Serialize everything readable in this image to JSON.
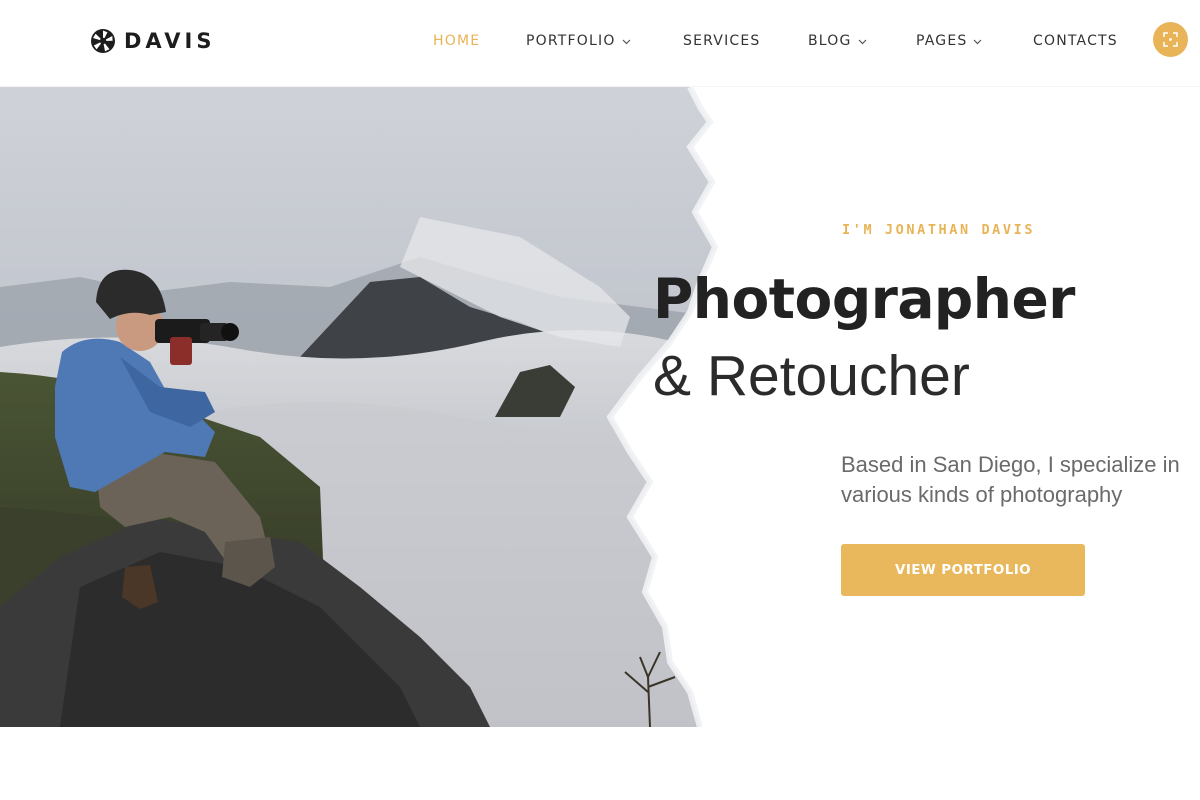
{
  "brand": {
    "name": "DAVIS",
    "logo_icon": "aperture-icon"
  },
  "nav": {
    "items": [
      {
        "label": "HOME",
        "active": true,
        "has_dropdown": false
      },
      {
        "label": "PORTFOLIO",
        "active": false,
        "has_dropdown": true
      },
      {
        "label": "SERVICES",
        "active": false,
        "has_dropdown": false
      },
      {
        "label": "BLOG",
        "active": false,
        "has_dropdown": true
      },
      {
        "label": "PAGES",
        "active": false,
        "has_dropdown": true
      },
      {
        "label": "CONTACTS",
        "active": false,
        "has_dropdown": false
      }
    ],
    "fullscreen_icon": "fullscreen-icon"
  },
  "hero": {
    "eyebrow": "I'M JONATHAN DAVIS",
    "headline_bold": "Photographer",
    "headline_light": "& Retoucher",
    "intro": "Based in San Diego, I specialize in various kinds of photography",
    "cta_label": "VIEW PORTFOLIO",
    "image": "photographer-on-mountain-above-clouds"
  },
  "colors": {
    "accent": "#e9b457",
    "text_dark": "#222222",
    "text_muted": "#6a6a6a",
    "background": "#ffffff"
  }
}
